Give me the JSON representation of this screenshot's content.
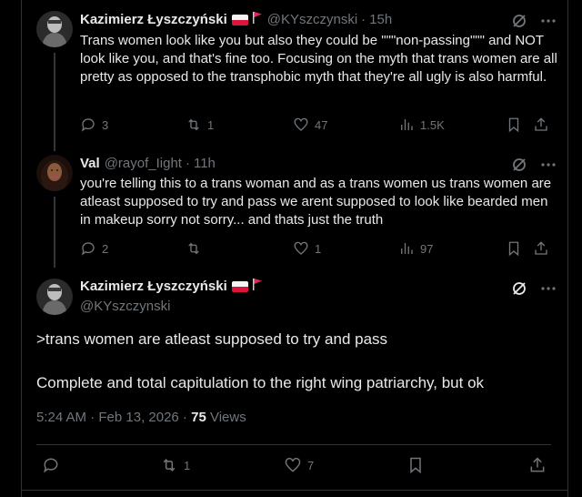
{
  "tweets": [
    {
      "name": "Kazimierz Łyszczyński",
      "handle": "@KYszczynski",
      "time": "15h",
      "text": "Trans women look like you but also they could be \"\"\"non-passing\"\"\" and NOT look like you, and that's fine too. Focusing on the myth that trans women are all pretty as opposed to the transphobic myth that they're all ugly is also harmful.",
      "replies": "3",
      "reposts": "1",
      "likes": "47",
      "views": "1.5K"
    },
    {
      "name": "Val",
      "handle": "@rayof_Iight",
      "time": "11h",
      "text": "you're telling this to a trans woman and as a trans women us trans women are atleast supposed to try and pass we arent supposed to look like bearded men in makeup sorry not sorry... and thats just the truth",
      "replies": "2",
      "reposts": "",
      "likes": "1",
      "views": "97"
    }
  ],
  "main": {
    "name": "Kazimierz Łyszczyński",
    "handle": "@KYszczynski",
    "line1": ">trans women are atleast supposed to try and pass",
    "line2": "Complete and total capitulation to the right wing patriarchy, but ok",
    "timestamp": "5:24 AM · Feb 13, 2026 · ",
    "views_count": "75",
    "views_label": " Views",
    "replies": "",
    "reposts": "1",
    "likes": "7"
  },
  "colors": {
    "background": "#000000",
    "text": "#e7e9ea",
    "muted": "#71767b",
    "border": "#2f3336"
  },
  "icons": [
    "grok-icon",
    "more-icon",
    "reply-icon",
    "repost-icon",
    "like-icon",
    "views-icon",
    "bookmark-icon",
    "share-icon"
  ]
}
